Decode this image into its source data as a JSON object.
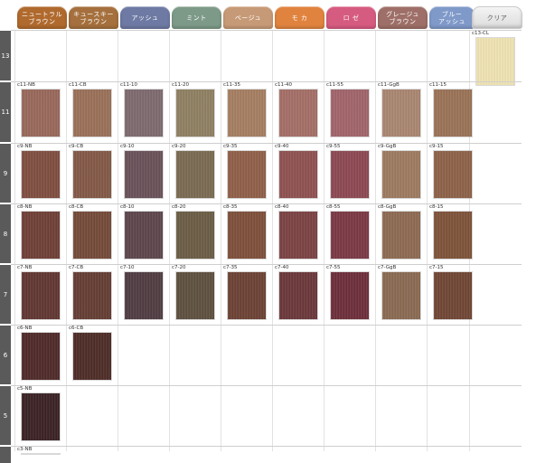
{
  "columns": [
    {
      "label1": "ニュートラル",
      "label2": "ブラウン",
      "color": "#b06a2e"
    },
    {
      "label1": "キュースキー",
      "label2": "ブラウン",
      "color": "#a5703d"
    },
    {
      "label1": "アッシュ",
      "label2": "",
      "color": "#6e7aa4"
    },
    {
      "label1": "ミント",
      "label2": "",
      "color": "#7d9a88"
    },
    {
      "label1": "ベージュ",
      "label2": "",
      "color": "#c79a77"
    },
    {
      "label1": "モ カ",
      "label2": "",
      "color": "#e0833f"
    },
    {
      "label1": "ロ ゼ",
      "label2": "",
      "color": "#d65b80"
    },
    {
      "label1": "グレージュ",
      "label2": "ブラウン",
      "color": "#9e6f68"
    },
    {
      "label1": "ブルー",
      "label2": "アッシュ",
      "color": "#7f99c9"
    },
    {
      "label1": "クリア",
      "label2": "",
      "color": "#ebebeb"
    }
  ],
  "levels": [
    {
      "level": "13",
      "cells": [
        null,
        null,
        null,
        null,
        null,
        null,
        null,
        null,
        null,
        {
          "code": "c13-CL",
          "color": "#efe3b2"
        }
      ]
    },
    {
      "level": "11",
      "cells": [
        {
          "code": "c11-NB",
          "color": "#98685a"
        },
        {
          "code": "c11-CB",
          "color": "#9a7058"
        },
        {
          "code": "c11-10",
          "color": "#7d6a6f"
        },
        {
          "code": "c11-20",
          "color": "#8f8062"
        },
        {
          "code": "c11-35",
          "color": "#a57e60"
        },
        {
          "code": "c11-40",
          "color": "#a46e66"
        },
        {
          "code": "c11-55",
          "color": "#a0646a"
        },
        {
          "code": "c11-GgB",
          "color": "#a98670"
        },
        {
          "code": "c11-15",
          "color": "#9a7257"
        },
        null
      ]
    },
    {
      "level": "9",
      "cells": [
        {
          "code": "c9-NB",
          "color": "#7f4d40"
        },
        {
          "code": "c9-CB",
          "color": "#835846"
        },
        {
          "code": "c9-10",
          "color": "#6a5158"
        },
        {
          "code": "c9-20",
          "color": "#7a6a52"
        },
        {
          "code": "c9-35",
          "color": "#8f5f48"
        },
        {
          "code": "c9-40",
          "color": "#8e5150"
        },
        {
          "code": "c9-55",
          "color": "#8c4853"
        },
        {
          "code": "c9-GgB",
          "color": "#9d7a60"
        },
        {
          "code": "c9-15",
          "color": "#8d6148"
        },
        null
      ]
    },
    {
      "level": "8",
      "cells": [
        {
          "code": "c8-NB",
          "color": "#6f3f36"
        },
        {
          "code": "c8-CB",
          "color": "#744a39"
        },
        {
          "code": "c8-10",
          "color": "#5d464c"
        },
        {
          "code": "c8-20",
          "color": "#6b5c45"
        },
        {
          "code": "c8-35",
          "color": "#7d4f3a"
        },
        {
          "code": "c8-40",
          "color": "#7b4243"
        },
        {
          "code": "c8-55",
          "color": "#7b3844"
        },
        {
          "code": "c8-GgB",
          "color": "#8d6a52"
        },
        {
          "code": "c8-15",
          "color": "#7e5239"
        },
        null
      ]
    },
    {
      "level": "7",
      "cells": [
        {
          "code": "c7-NB",
          "color": "#613631"
        },
        {
          "code": "c7-CB",
          "color": "#643d33"
        },
        {
          "code": "c7-10",
          "color": "#503c42"
        },
        {
          "code": "c7-20",
          "color": "#5e503f"
        },
        {
          "code": "c7-35",
          "color": "#6c4234"
        },
        {
          "code": "c7-40",
          "color": "#6b373a"
        },
        {
          "code": "c7-55",
          "color": "#6d2e3a"
        },
        {
          "code": "c7-GgB",
          "color": "#8a6a52"
        },
        {
          "code": "c7-15",
          "color": "#704634"
        },
        null
      ]
    },
    {
      "level": "6",
      "cells": [
        {
          "code": "c6-NB",
          "color": "#4f2a29"
        },
        {
          "code": "c6-CB",
          "color": "#4e2c27"
        },
        null,
        null,
        null,
        null,
        null,
        null,
        null,
        null
      ]
    },
    {
      "level": "5",
      "cells": [
        {
          "code": "c5-NB",
          "color": "#3b2224"
        },
        null,
        null,
        null,
        null,
        null,
        null,
        null,
        null,
        null
      ]
    },
    {
      "level": "",
      "cells": [
        {
          "code": "c3-NB",
          "color": "#2a1a1c"
        },
        null,
        null,
        null,
        null,
        null,
        null,
        null,
        null,
        null
      ]
    }
  ]
}
